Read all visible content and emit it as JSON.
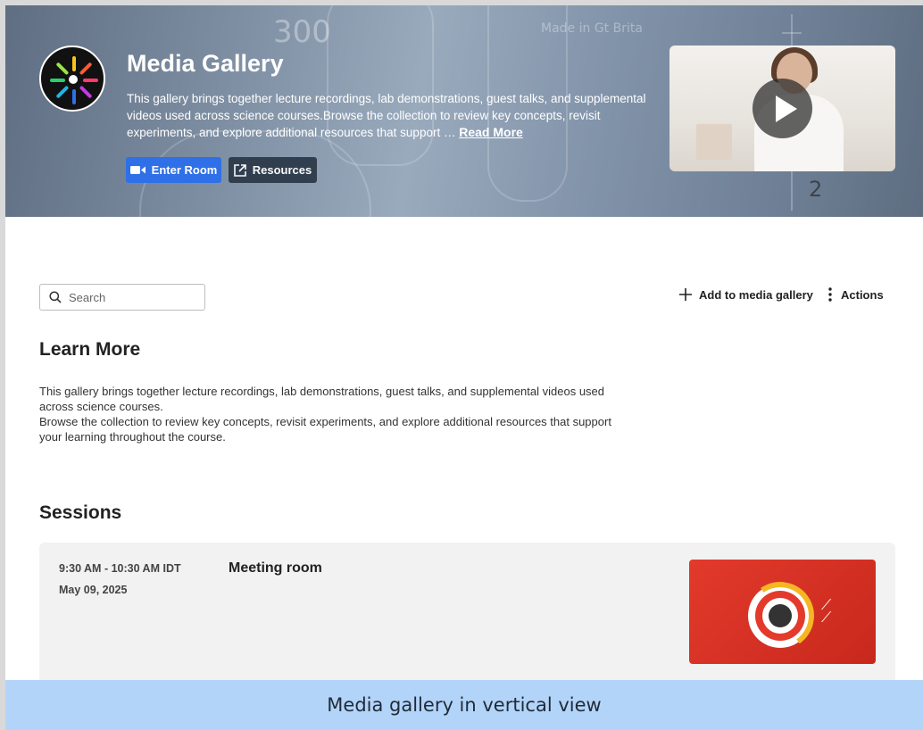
{
  "hero": {
    "title": "Media Gallery",
    "description": "This gallery brings together lecture recordings, lab demonstrations, guest talks, and supplemental videos used across science courses.Browse the collection to review key concepts, revisit experiments, and explore additional resources that support …",
    "read_more": "Read More",
    "enter_room": "Enter Room",
    "resources": "Resources",
    "brand_color": "#2f6fe8",
    "bg_text_1": "300",
    "bg_text_2": "Made in Gt Brita",
    "bg_text_3": "2"
  },
  "toolbar": {
    "search_placeholder": "Search",
    "add_label": "Add to media gallery",
    "actions_label": "Actions"
  },
  "learn_more": {
    "title": "Learn More",
    "paragraph_1": "This gallery brings together lecture recordings, lab demonstrations, guest talks, and supplemental videos used across science courses.",
    "paragraph_2": "Browse the collection to review key concepts, revisit experiments, and explore additional resources that support your learning throughout the course."
  },
  "sessions": {
    "title": "Sessions",
    "items": [
      {
        "time": "9:30 AM - 10:30 AM IDT",
        "date": "May 09, 2025",
        "name": "Meeting room",
        "thumb_color": "#e23a2c"
      }
    ]
  },
  "caption": "Media gallery in vertical view",
  "icons": {
    "logo": "sunburst-logo-icon",
    "video": "video-camera-icon",
    "external": "external-link-icon",
    "search": "search-icon",
    "plus": "plus-icon",
    "kebab": "kebab-menu-icon",
    "play": "play-icon"
  }
}
